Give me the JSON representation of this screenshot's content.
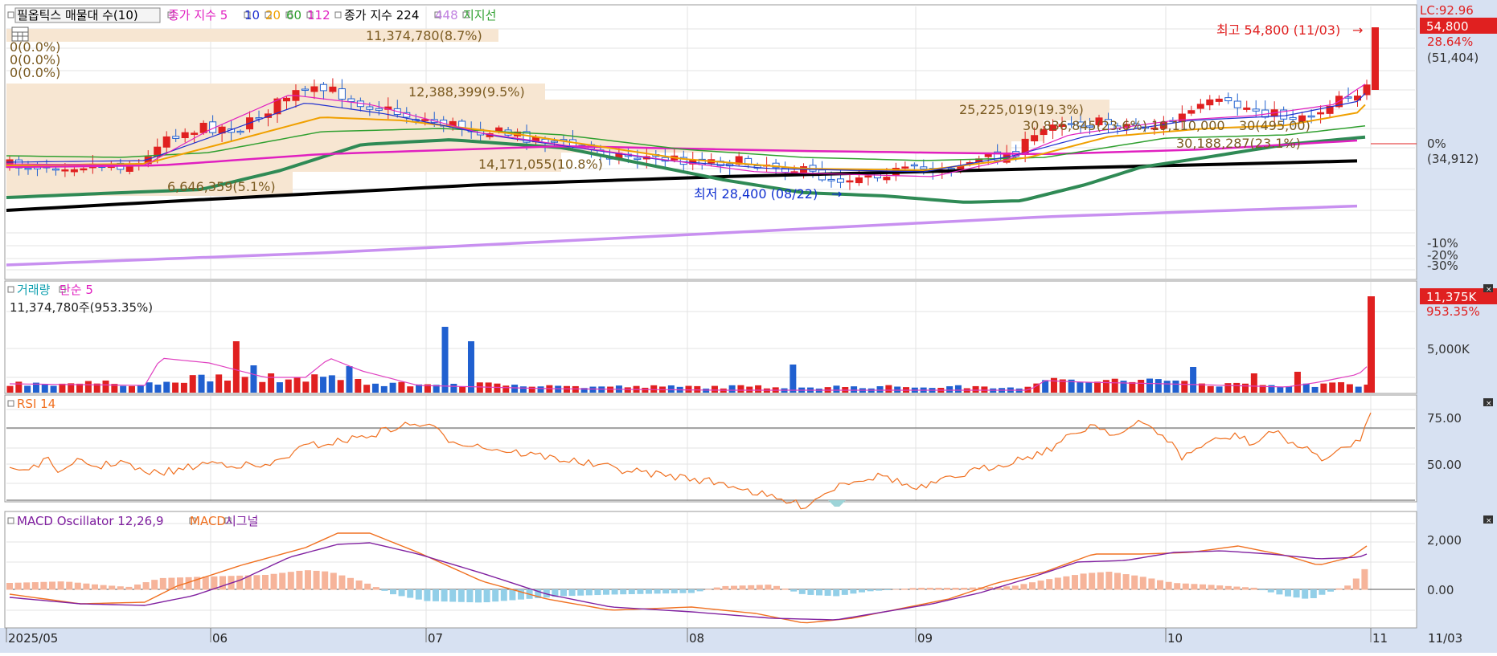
{
  "panels": {
    "price": {
      "legend": [
        {
          "text": "필옵틱스 매물대 수(10)",
          "color": "#000000",
          "boxed": true
        },
        {
          "text": "종가 지수 5",
          "color": "#e020c0"
        },
        {
          "text": "10",
          "color": "#2030d0"
        },
        {
          "text": "20",
          "color": "#f0a000"
        },
        {
          "text": "60",
          "color": "#30a030"
        },
        {
          "text": "112",
          "color": "#e020c0"
        },
        {
          "text": "종가 지수 224",
          "color": "#000000",
          "gap": true
        },
        {
          "text": "448",
          "color": "#c080e0"
        },
        {
          "text": "지지선",
          "color": "#30a030"
        }
      ],
      "lc_label": "LC:92.96",
      "current_price": "54,800",
      "pct_top": "28.64%",
      "ref_top": "(51,404)",
      "zero_pct": "0%",
      "ref_zero": "(34,912)",
      "axis_ticks": [
        "-10%",
        "-20%",
        "-30%"
      ],
      "max_label": "최고 54,800 (11/03)",
      "min_label": "최저 28,400 (08/22)",
      "zero_rows": [
        "0(0.0%)",
        "0(0.0%)",
        "0(0.0%)"
      ],
      "volume_profile": [
        {
          "label": "11,374,780(8.7%)"
        },
        {
          "label": "12,388,399(9.5%)"
        },
        {
          "label": "25,225,019(19.3%)"
        },
        {
          "label": "30,836,845(23.6%)"
        },
        {
          "label": "19,110,000"
        },
        {
          "label": "30(495,00)"
        },
        {
          "label": "30,188,287(23.1%)"
        },
        {
          "label": "14,171,055(10.8%)"
        },
        {
          "label": "6,646,359(5.1%)"
        }
      ]
    },
    "volume": {
      "legend": [
        {
          "text": "거래량",
          "color": "#10a0b0"
        },
        {
          "text": "단순 5",
          "color": "#e020c0"
        }
      ],
      "sub_label": "11,374,780주(953.35%)",
      "current": "11,375K",
      "pct": "953.35%",
      "axis_tick": "5,000K"
    },
    "rsi": {
      "legend": [
        {
          "text": "RSI 14",
          "color": "#f07020"
        }
      ],
      "axis_ticks": [
        "75.00",
        "50.00"
      ]
    },
    "macd": {
      "legend": [
        {
          "text": "MACD Oscillator 12,26,9",
          "color": "#8020a0"
        },
        {
          "text": "MACD",
          "color": "#f07020"
        },
        {
          "text": "시그널",
          "color": "#8020a0"
        }
      ],
      "axis_ticks": [
        "2,000",
        "0.00"
      ]
    }
  },
  "xaxis": {
    "labels": [
      "2025/05",
      "06",
      "07",
      "08",
      "09",
      "10",
      "11"
    ],
    "last_date": "11/03"
  },
  "chart_data": [
    {
      "type": "candlestick",
      "title": "필옵틱스 매물대 수(10)",
      "x_range": [
        "2025/05",
        "11/03"
      ],
      "price_range": [
        28400,
        54800
      ],
      "high": {
        "value": 54800,
        "date": "11/03"
      },
      "low": {
        "value": 28400,
        "date": "08/22"
      },
      "current": 54800,
      "reference_price": 34912,
      "volume_profile": [
        11374780,
        12388399,
        25225019,
        30836845,
        30188287,
        14171055,
        6646359
      ],
      "volume_profile_pct": [
        8.7,
        9.5,
        19.3,
        23.6,
        23.1,
        10.8,
        5.1
      ]
    },
    {
      "type": "bar",
      "title": "거래량",
      "series": [
        {
          "name": "단순 5"
        }
      ],
      "last_value": 11374780,
      "last_pct": 953.35
    },
    {
      "type": "line",
      "title": "RSI 14",
      "ylim": [
        40,
        80
      ],
      "yticks": [
        50,
        75
      ]
    },
    {
      "type": "line",
      "title": "MACD Oscillator 12,26,9",
      "series": [
        {
          "name": "MACD"
        },
        {
          "name": "시그널"
        }
      ],
      "yticks": [
        0,
        2000
      ]
    }
  ]
}
